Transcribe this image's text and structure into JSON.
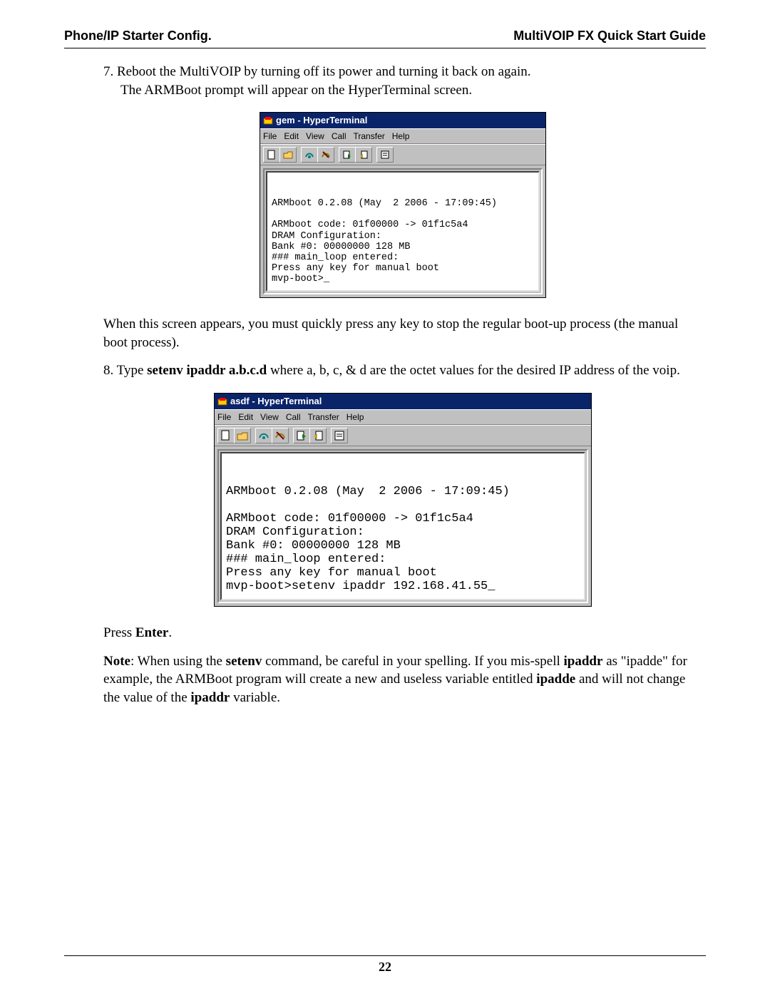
{
  "header": {
    "left": "Phone/IP Starter Config.",
    "right": "MultiVOIP FX Quick Start Guide"
  },
  "step7": {
    "num": "7.",
    "line1": "Reboot the MultiVOIP by turning off its power and turning it back on again.",
    "line2": "The ARMBoot prompt will appear on the HyperTerminal screen."
  },
  "win1": {
    "title": "gem - HyperTerminal",
    "menu": {
      "file": "File",
      "edit": "Edit",
      "view": "View",
      "call": "Call",
      "transfer": "Transfer",
      "help": "Help"
    },
    "icons": [
      "new-icon",
      "open-icon",
      "connect-icon",
      "disconnect-icon",
      "send-icon",
      "receive-icon",
      "properties-icon"
    ],
    "term": "\n\nARMboot 0.2.08 (May  2 2006 - 17:09:45)\n\nARMboot code: 01f00000 -> 01f1c5a4\nDRAM Configuration:\nBank #0: 00000000 128 MB\n### main_loop entered:\nPress any key for manual boot\nmvp-boot>_"
  },
  "mid_para": "When this screen appears, you must quickly press any key to stop the regular boot-up process (the manual boot process).",
  "step8": {
    "num": "8.",
    "pre": "Type ",
    "cmd": "setenv ipaddr a.b.c.d",
    "post": " where a, b, c, & d are the octet values for the desired IP address of the voip."
  },
  "win2": {
    "title": "asdf - HyperTerminal",
    "menu": {
      "file": "File",
      "edit": "Edit",
      "view": "View",
      "call": "Call",
      "transfer": "Transfer",
      "help": "Help"
    },
    "icons": [
      "new-icon",
      "open-icon",
      "connect-icon",
      "disconnect-icon",
      "send-icon",
      "receive-icon",
      "properties-icon"
    ],
    "term": "\n\nARMboot 0.2.08 (May  2 2006 - 17:09:45)\n\nARMboot code: 01f00000 -> 01f1c5a4\nDRAM Configuration:\nBank #0: 00000000 128 MB\n### main_loop entered:\nPress any key for manual boot\nmvp-boot>setenv ipaddr 192.168.41.55_"
  },
  "press_enter": {
    "pre": "Press ",
    "key": "Enter",
    "post": "."
  },
  "note": {
    "label": "Note",
    "t1": ": When using the ",
    "b1": "setenv",
    "t2": " command, be careful in your spelling.  If you mis-spell ",
    "b2": "ipaddr",
    "t3": " as \"ipadde\" for example, the ARMBoot program will create a new and useless variable entitled ",
    "b3": "ipadde",
    "t4": " and will not change the value of the ",
    "b4": "ipaddr",
    "t5": " variable."
  },
  "page_number": "22"
}
